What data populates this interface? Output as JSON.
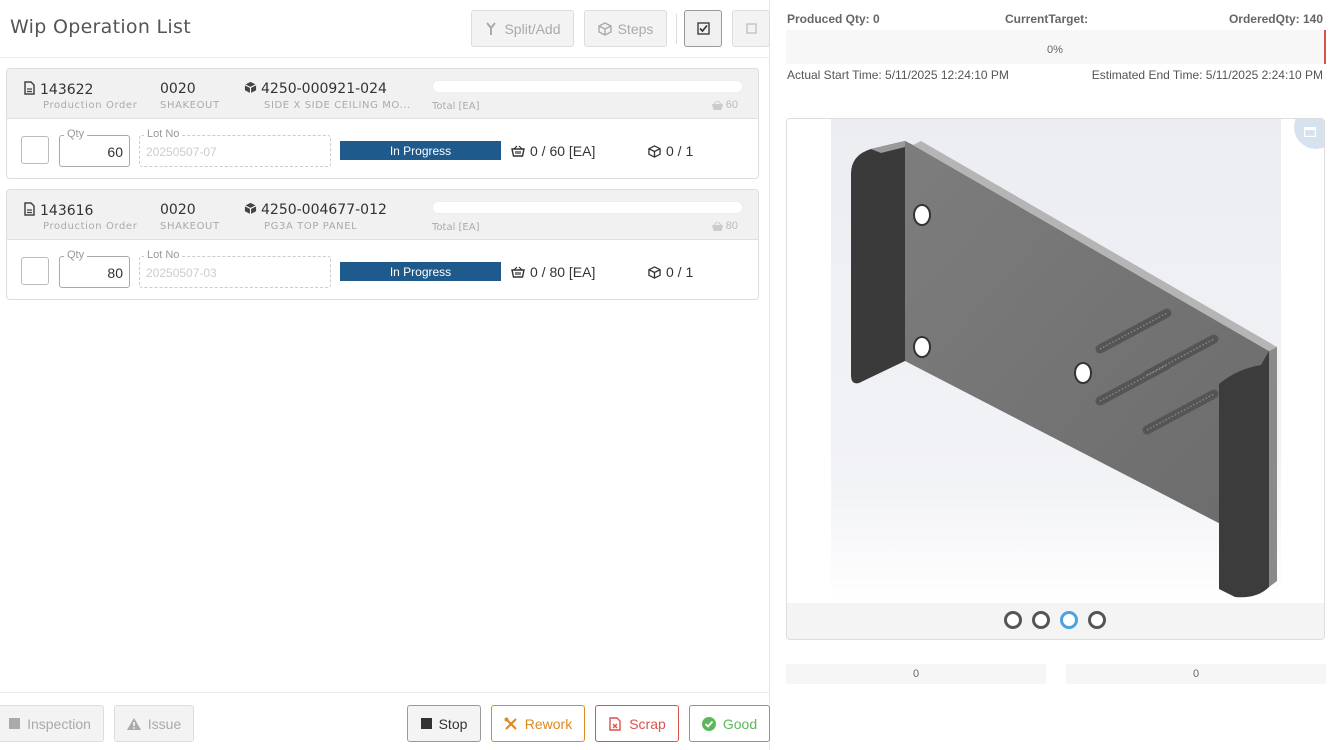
{
  "header": {
    "title": "Wip Operation List",
    "split_label": "Split/Add",
    "steps_label": "Steps"
  },
  "orders": [
    {
      "order_no": "143622",
      "order_label": "Production Order",
      "op_no": "0020",
      "op_name": "SHAKEOUT",
      "part_no": "4250-000921-024",
      "part_desc": "SIDE X SIDE CEILING MO...",
      "total_label": "Total [EA]",
      "total_value": "60",
      "qty_label": "Qty",
      "qty_value": "60",
      "lot_label": "Lot No",
      "lot_placeholder": "20250507-07",
      "status": "In Progress",
      "progress": "0 / 60 [EA]",
      "steps": "0 / 1"
    },
    {
      "order_no": "143616",
      "order_label": "Production Order",
      "op_no": "0020",
      "op_name": "SHAKEOUT",
      "part_no": "4250-004677-012",
      "part_desc": "PG3A TOP PANEL",
      "total_label": "Total [EA]",
      "total_value": "80",
      "qty_label": "Qty",
      "qty_value": "80",
      "lot_label": "Lot No",
      "lot_placeholder": "20250507-03",
      "status": "In Progress",
      "progress": "0 / 80 [EA]",
      "steps": "0 / 1"
    }
  ],
  "footer": {
    "inspection": "Inspection",
    "issue": "Issue",
    "stop": "Stop",
    "rework": "Rework",
    "scrap": "Scrap",
    "good": "Good"
  },
  "stats": {
    "produced": "Produced Qty: 0",
    "current_target": "CurrentTarget:",
    "ordered": "OrderedQty: 140",
    "target_percent": "0%",
    "start_time": "Actual Start Time: 5/11/2025 12:24:10 PM",
    "end_time": "Estimated End Time: 5/11/2025 2:24:10 PM"
  },
  "carousel": {
    "count": 4,
    "active": 2
  },
  "summary": {
    "left": "0",
    "right": "0"
  },
  "colors": {
    "status": "#1f5a8c",
    "rework": "#e0891f",
    "scrap": "#d9534f",
    "good": "#5cb85c",
    "active_dot": "#4aa3df"
  }
}
